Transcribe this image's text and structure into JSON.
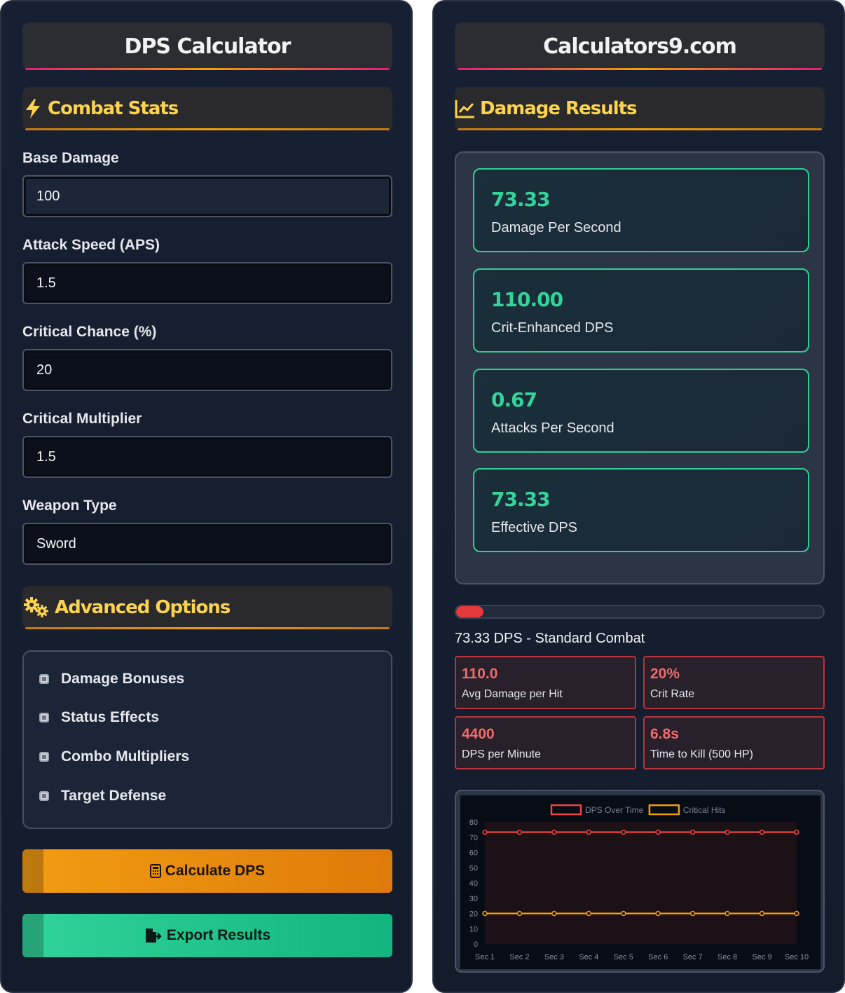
{
  "left": {
    "title": "DPS Calculator",
    "combat_section": {
      "title": "Combat Stats",
      "icon": "lightning-icon"
    },
    "fields": [
      {
        "label": "Base Damage",
        "value": "100"
      },
      {
        "label": "Attack Speed (APS)",
        "value": "1.5"
      },
      {
        "label": "Critical Chance (%)",
        "value": "20"
      },
      {
        "label": "Critical Multiplier",
        "value": "1.5"
      },
      {
        "label": "Weapon Type",
        "value": "Sword"
      }
    ],
    "advanced_section": {
      "title": "Advanced Options",
      "icon": "gears-icon"
    },
    "advanced_options": [
      {
        "label": "Damage Bonuses",
        "checked": false
      },
      {
        "label": "Status Effects",
        "checked": false
      },
      {
        "label": "Combo Multipliers",
        "checked": false
      },
      {
        "label": "Target Defense",
        "checked": false
      }
    ],
    "buttons": {
      "calculate": "Calculate DPS",
      "export": "Export Results"
    }
  },
  "right": {
    "title": "Calculators9.com",
    "results_section": {
      "title": "Damage Results",
      "icon": "chart-line-icon"
    },
    "results": [
      {
        "value": "73.33",
        "label": "Damage Per Second"
      },
      {
        "value": "110.00",
        "label": "Crit-Enhanced DPS"
      },
      {
        "value": "0.67",
        "label": "Attacks Per Second"
      },
      {
        "value": "73.33",
        "label": "Effective DPS"
      }
    ],
    "progress": {
      "fraction": 0.075,
      "text": "73.33 DPS - Standard Combat"
    },
    "stats": [
      {
        "value": "110.0",
        "label": "Avg Damage per Hit"
      },
      {
        "value": "20%",
        "label": "Crit Rate"
      },
      {
        "value": "4400",
        "label": "DPS per Minute"
      },
      {
        "value": "6.8s",
        "label": "Time to Kill (500 HP)"
      }
    ]
  },
  "colors": {
    "accent_orange": "#f59e0b",
    "accent_green": "#34d399",
    "accent_red": "#ef4444",
    "title_yellow": "#fcd34d"
  },
  "chart_data": {
    "type": "line",
    "categories": [
      "Sec 1",
      "Sec 2",
      "Sec 3",
      "Sec 4",
      "Sec 5",
      "Sec 6",
      "Sec 7",
      "Sec 8",
      "Sec 9",
      "Sec 10"
    ],
    "series": [
      {
        "name": "DPS Over Time",
        "color": "#ef4444",
        "values": [
          73.33,
          73.33,
          73.33,
          73.33,
          73.33,
          73.33,
          73.33,
          73.33,
          73.33,
          73.33
        ]
      },
      {
        "name": "Critical Hits",
        "color": "#f59e0b",
        "values": [
          20,
          20,
          20,
          20,
          20,
          20,
          20,
          20,
          20,
          20
        ]
      }
    ],
    "ylim": [
      0,
      80
    ],
    "yticks": [
      0,
      10,
      20,
      30,
      40,
      50,
      60,
      70,
      80
    ],
    "legend": "top-center",
    "grid": false
  }
}
